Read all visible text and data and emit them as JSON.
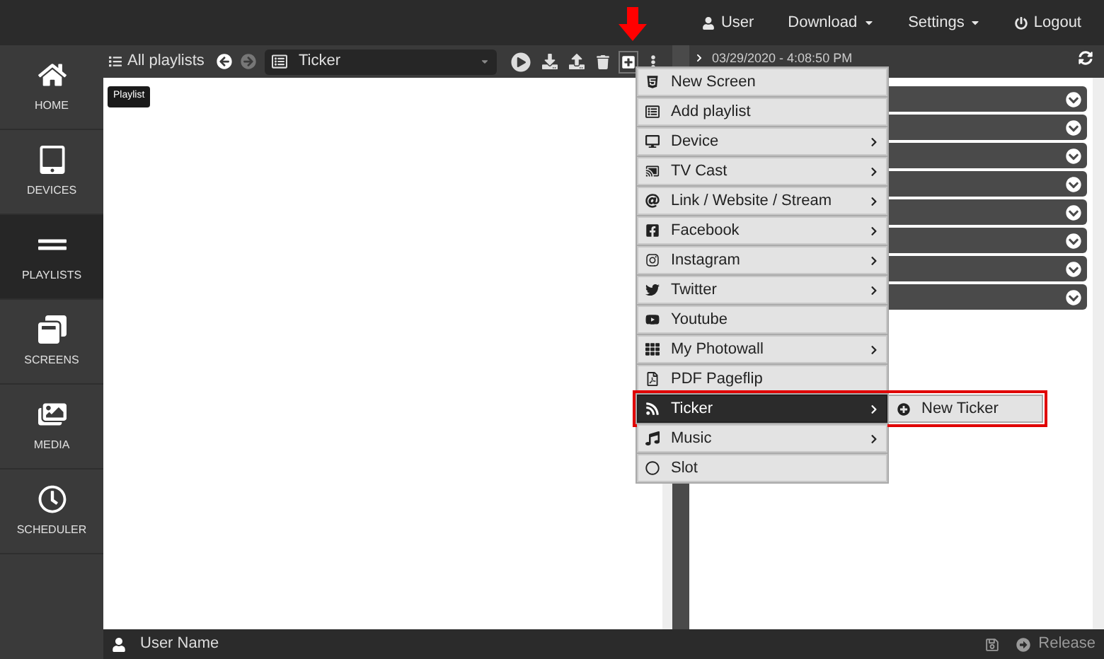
{
  "top_nav": {
    "user": "User",
    "download": "Download",
    "settings": "Settings",
    "logout": "Logout"
  },
  "sidebar": {
    "items": [
      {
        "label": "HOME",
        "selected": false
      },
      {
        "label": "DEVICES",
        "selected": false
      },
      {
        "label": "PLAYLISTS",
        "selected": true
      },
      {
        "label": "SCREENS",
        "selected": false
      },
      {
        "label": "MEDIA",
        "selected": false
      },
      {
        "label": "SCHEDULER",
        "selected": false
      }
    ]
  },
  "toolbar": {
    "all_playlists": "All playlists",
    "playlist_select": {
      "value": "Ticker"
    },
    "tooltip": "Playlist"
  },
  "right_panel": {
    "date": "03/29/2020 - 4:08:50 PM",
    "groups": [
      {
        "expanded": false
      },
      {
        "expanded": false
      },
      {
        "expanded": false
      },
      {
        "expanded": false
      },
      {
        "expanded": false
      },
      {
        "expanded": false
      },
      {
        "expanded": false
      },
      {
        "expanded": false
      }
    ]
  },
  "add_menu": {
    "items": [
      {
        "label": "New Screen",
        "submenu": false,
        "selected": false
      },
      {
        "label": "Add playlist",
        "submenu": false,
        "selected": false
      },
      {
        "label": "Device",
        "submenu": true,
        "selected": false
      },
      {
        "label": "TV Cast",
        "submenu": true,
        "selected": false
      },
      {
        "label": "Link / Website / Stream",
        "submenu": true,
        "selected": false
      },
      {
        "label": "Facebook",
        "submenu": true,
        "selected": false
      },
      {
        "label": "Instagram",
        "submenu": true,
        "selected": false
      },
      {
        "label": "Twitter",
        "submenu": true,
        "selected": false
      },
      {
        "label": "Youtube",
        "submenu": false,
        "selected": false
      },
      {
        "label": "My Photowall",
        "submenu": true,
        "selected": false
      },
      {
        "label": "PDF Pageflip",
        "submenu": false,
        "selected": false
      },
      {
        "label": "Ticker",
        "submenu": true,
        "selected": true,
        "children": [
          {
            "label": "New Ticker"
          }
        ]
      },
      {
        "label": "Music",
        "submenu": true,
        "selected": false
      },
      {
        "label": "Slot",
        "submenu": false,
        "selected": false
      }
    ]
  },
  "footer": {
    "user_name": "User Name",
    "release": "Release"
  }
}
